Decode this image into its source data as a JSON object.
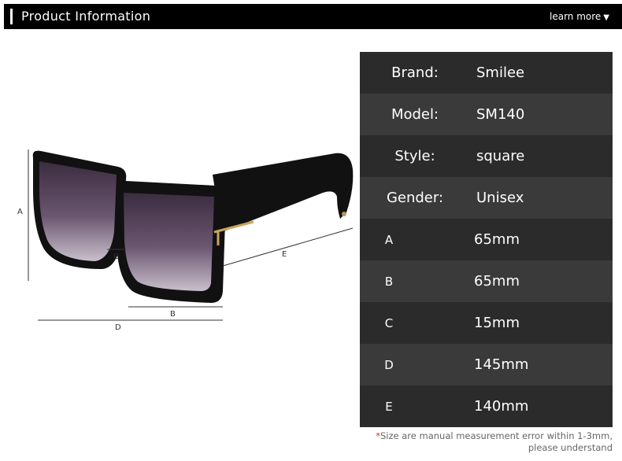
{
  "header": {
    "title": "Product Information",
    "learn_more": "learn more",
    "learn_more_arrow": "▼"
  },
  "diagram": {
    "labels": {
      "a": "A",
      "b": "B",
      "c": "C",
      "d": "D",
      "e": "E"
    }
  },
  "specs": [
    {
      "label": "Brand:",
      "value": "Smilee"
    },
    {
      "label": "Model:",
      "value": "SM140"
    },
    {
      "label": "Style:",
      "value": "square"
    },
    {
      "label": "Gender:",
      "value": "Unisex"
    },
    {
      "label": "A",
      "value": "65mm"
    },
    {
      "label": "B",
      "value": "65mm"
    },
    {
      "label": "C",
      "value": "15mm"
    },
    {
      "label": "D",
      "value": "145mm"
    },
    {
      "label": "E",
      "value": "140mm"
    }
  ],
  "note": {
    "star": "*",
    "line1": "Size are manual measurement error within 1-3mm,",
    "line2": "please understand"
  },
  "colors": {
    "header_bg": "#000000",
    "row_dark": "#2b2b2b",
    "row_light": "#3a3a3a",
    "lens": "#5e4a66",
    "frame": "#111111"
  }
}
